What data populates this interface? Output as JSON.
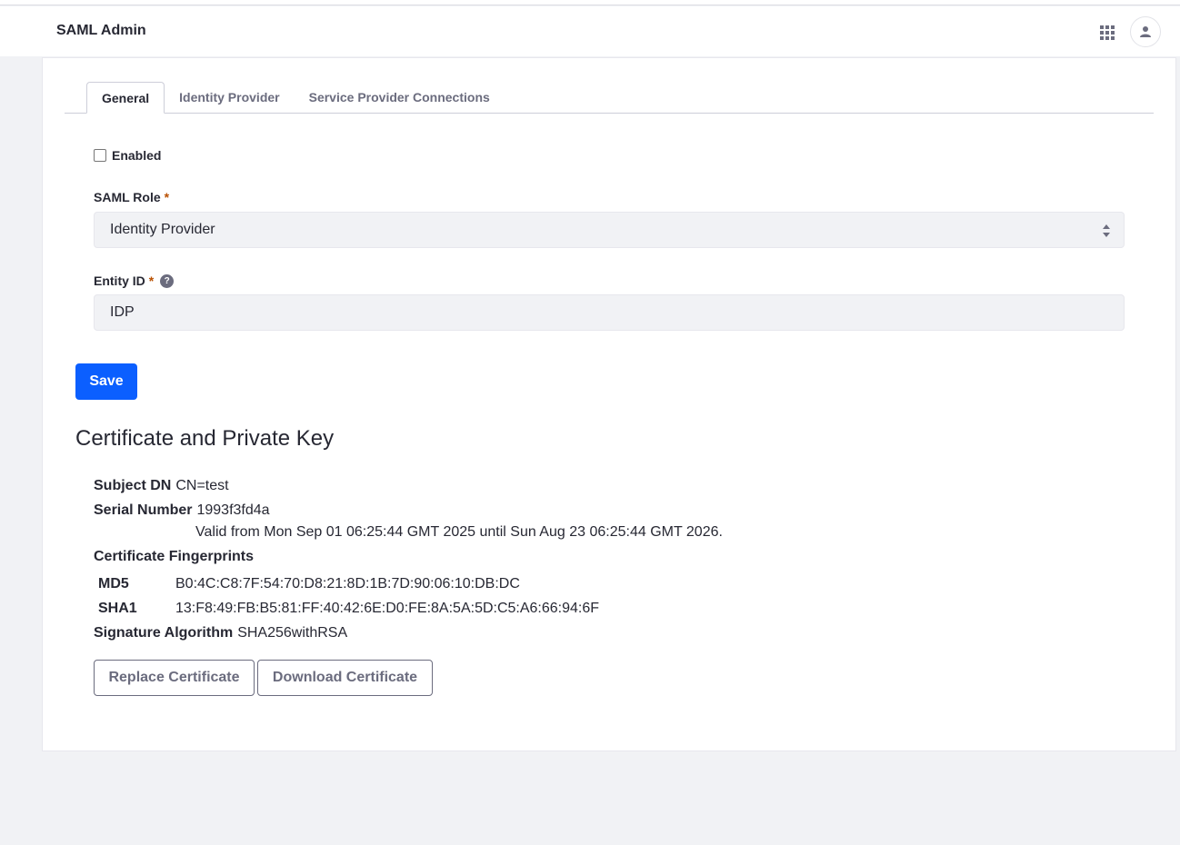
{
  "header": {
    "title": "SAML Admin"
  },
  "tabs": [
    {
      "label": "General",
      "active": true
    },
    {
      "label": "Identity Provider",
      "active": false
    },
    {
      "label": "Service Provider Connections",
      "active": false
    }
  ],
  "form": {
    "enabled_label": "Enabled",
    "enabled_checked": false,
    "saml_role_label": "SAML Role",
    "saml_role_value": "Identity Provider",
    "entity_id_label": "Entity ID",
    "entity_id_value": "IDP",
    "required_mark": "*",
    "help_glyph": "?",
    "save_label": "Save"
  },
  "certificate": {
    "title": "Certificate and Private Key",
    "subject_dn_label": "Subject DN",
    "subject_dn_value": "CN=test",
    "serial_label": "Serial Number",
    "serial_value": "1993f3fd4a",
    "validity": "Valid from Mon Sep 01 06:25:44 GMT 2025 until Sun Aug 23 06:25:44 GMT 2026.",
    "fingerprints_label": "Certificate Fingerprints",
    "md5_label": "MD5",
    "md5_value": "B0:4C:C8:7F:54:70:D8:21:8D:1B:7D:90:06:10:DB:DC",
    "sha1_label": "SHA1",
    "sha1_value": "13:F8:49:FB:B5:81:FF:40:42:6E:D0:FE:8A:5A:5D:C5:A6:66:94:6F",
    "sig_alg_label": "Signature Algorithm",
    "sig_alg_value": "SHA256withRSA",
    "replace_label": "Replace Certificate",
    "download_label": "Download Certificate"
  },
  "icons": {
    "apps": "apps-grid-icon",
    "user": "user-icon",
    "select": "select-arrows-icon",
    "help": "help-icon"
  },
  "colors": {
    "primary": "#0b5fff",
    "required": "#b95000",
    "page_bg": "#f1f2f5"
  }
}
